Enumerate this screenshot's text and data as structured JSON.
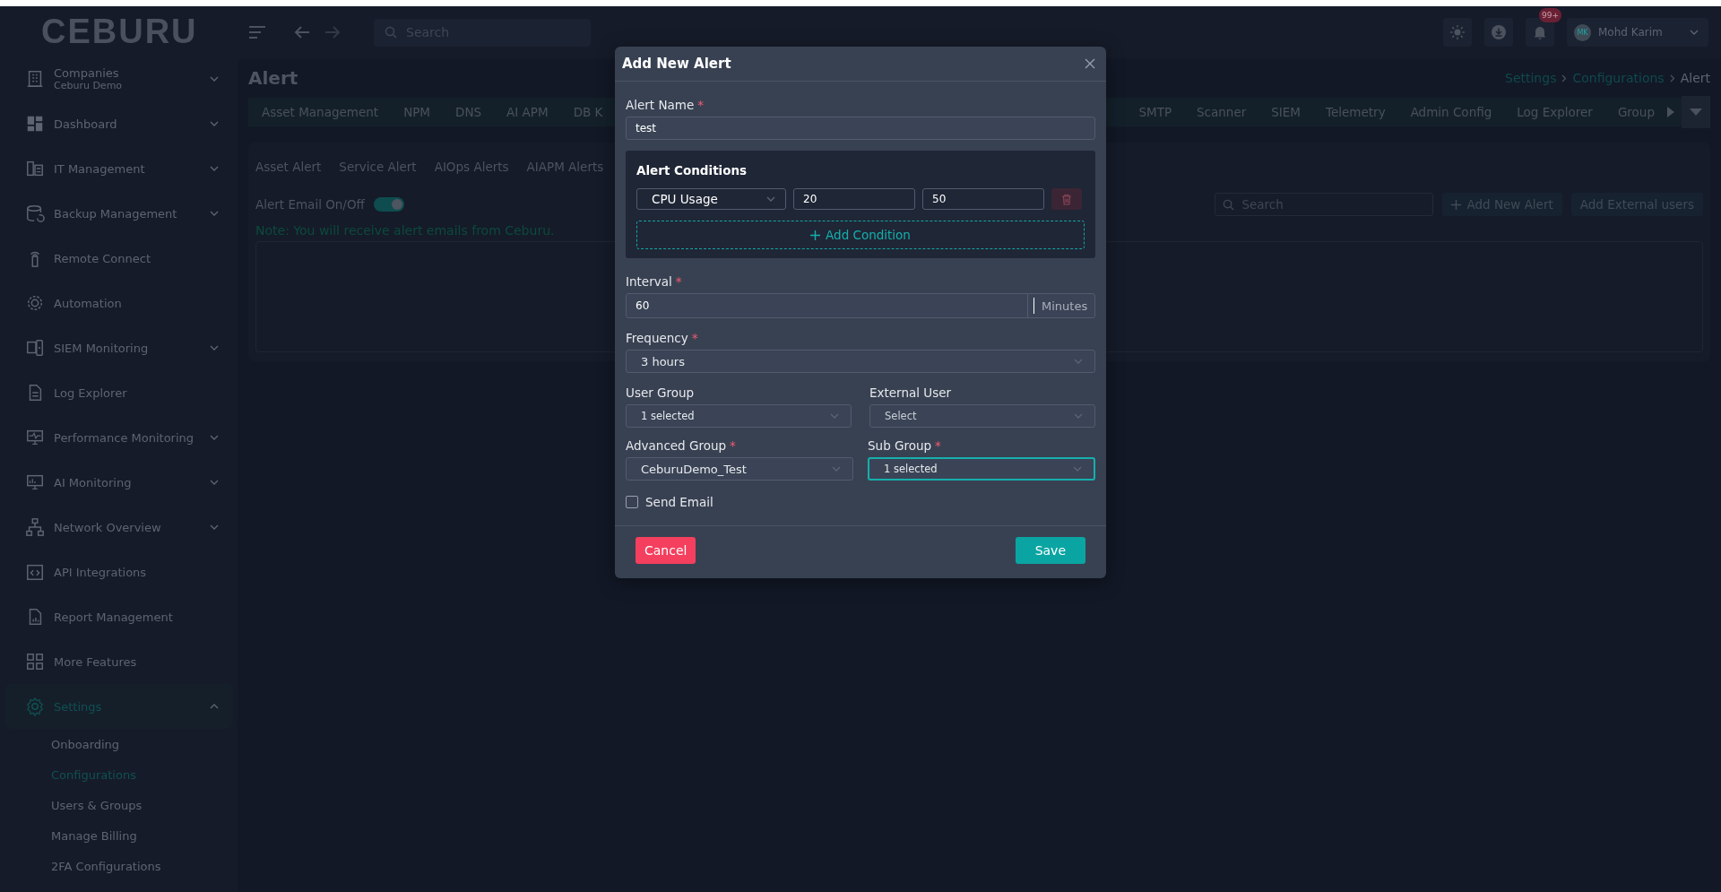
{
  "sidebar": {
    "logo": "CEBURU",
    "items": [
      {
        "label": "Companies",
        "sublabel": "Ceburu Demo",
        "expanded": false,
        "selected": false
      },
      {
        "label": "Dashboard",
        "expanded": false,
        "selected": false
      },
      {
        "label": "IT Management",
        "expanded": false,
        "selected": false
      },
      {
        "label": "Backup Management",
        "expanded": false,
        "selected": false
      },
      {
        "label": "Remote Connect",
        "selected": false
      },
      {
        "label": "Automation",
        "selected": false
      },
      {
        "label": "SIEM Monitoring",
        "expanded": false,
        "selected": false
      },
      {
        "label": "Log Explorer",
        "selected": false
      },
      {
        "label": "Performance Monitoring",
        "expanded": false,
        "selected": false
      },
      {
        "label": "AI Monitoring",
        "expanded": false,
        "selected": false
      },
      {
        "label": "Network Overview",
        "expanded": false,
        "selected": false
      },
      {
        "label": "API Integrations",
        "selected": false
      },
      {
        "label": "Report Management",
        "selected": false
      },
      {
        "label": "More Features",
        "selected": false
      },
      {
        "label": "Settings",
        "expanded": true,
        "selected": true,
        "children": [
          {
            "label": "Onboarding",
            "selected": false
          },
          {
            "label": "Configurations",
            "selected": true
          },
          {
            "label": "Users & Groups",
            "selected": false
          },
          {
            "label": "Manage Billing",
            "selected": false
          },
          {
            "label": "2FA Configurations",
            "selected": false
          }
        ]
      }
    ]
  },
  "topbar": {
    "search": {
      "placeholder": "Search"
    },
    "notifications_badge": "99+",
    "user": {
      "initials": "MK",
      "name": "Mohd Karim"
    }
  },
  "page": {
    "title": "Alert",
    "breadcrumb": [
      {
        "label": "Settings",
        "link": true
      },
      {
        "label": "Configurations",
        "link": true
      },
      {
        "label": "Alert",
        "link": false
      }
    ],
    "tabs_left": [
      {
        "label": "Asset Management",
        "selected": false
      },
      {
        "label": "NPM",
        "selected": false
      },
      {
        "label": "DNS",
        "selected": false
      },
      {
        "label": "AI APM",
        "selected": false
      },
      {
        "label": "DB K",
        "selected": false
      }
    ],
    "tabs_right": [
      {
        "label": "SMTP",
        "selected": false
      },
      {
        "label": "Scanner",
        "selected": false
      },
      {
        "label": "SIEM",
        "selected": false
      },
      {
        "label": "Telemetry",
        "selected": false
      },
      {
        "label": "Admin Config",
        "selected": false
      },
      {
        "label": "Log Explorer",
        "selected": false
      },
      {
        "label": "Group",
        "selected": false
      }
    ],
    "subtabs": [
      {
        "label": "Asset Alert",
        "selected": false
      },
      {
        "label": "Service Alert",
        "selected": false
      },
      {
        "label": "AIOps Alerts",
        "selected": false
      },
      {
        "label": "AIAPM Alerts",
        "selected": false
      }
    ],
    "email_toggle": {
      "label": "Alert Email On/Off",
      "on": true
    },
    "note": "Note: You will receive alert emails from Ceburu.",
    "search": {
      "placeholder": "Search"
    },
    "actions": [
      {
        "label": "Add New Alert",
        "kind": "add"
      },
      {
        "label": "Add External users",
        "kind": "plain"
      }
    ]
  },
  "dialog": {
    "title": "Add New Alert",
    "alert_name": {
      "label": "Alert Name",
      "required_mark": "*",
      "value": "test"
    },
    "conditions": {
      "title": "Alert Conditions",
      "rows": [
        {
          "metric": "CPU Usage",
          "min": "20",
          "max": "50"
        }
      ],
      "add_label": "Add Condition"
    },
    "interval": {
      "label": "Interval",
      "required_mark": "*",
      "value": "60",
      "unit": "Minutes"
    },
    "frequency": {
      "label": "Frequency",
      "required_mark": "*",
      "value": "3 hours"
    },
    "user_group": {
      "label": "User Group",
      "value": "1 selected",
      "focused": false
    },
    "external_user": {
      "label": "External User",
      "placeholder": "Select",
      "focused": false
    },
    "advanced_group": {
      "label": "Advanced Group",
      "required_mark": "*",
      "value": "CeburuDemo_Test",
      "focused": false
    },
    "sub_group": {
      "label": "Sub Group",
      "required_mark": "*",
      "value": "1 selected",
      "focused": true
    },
    "send_email": {
      "label": "Send Email",
      "checked": false
    },
    "cancel": "Cancel",
    "save": "Save"
  }
}
